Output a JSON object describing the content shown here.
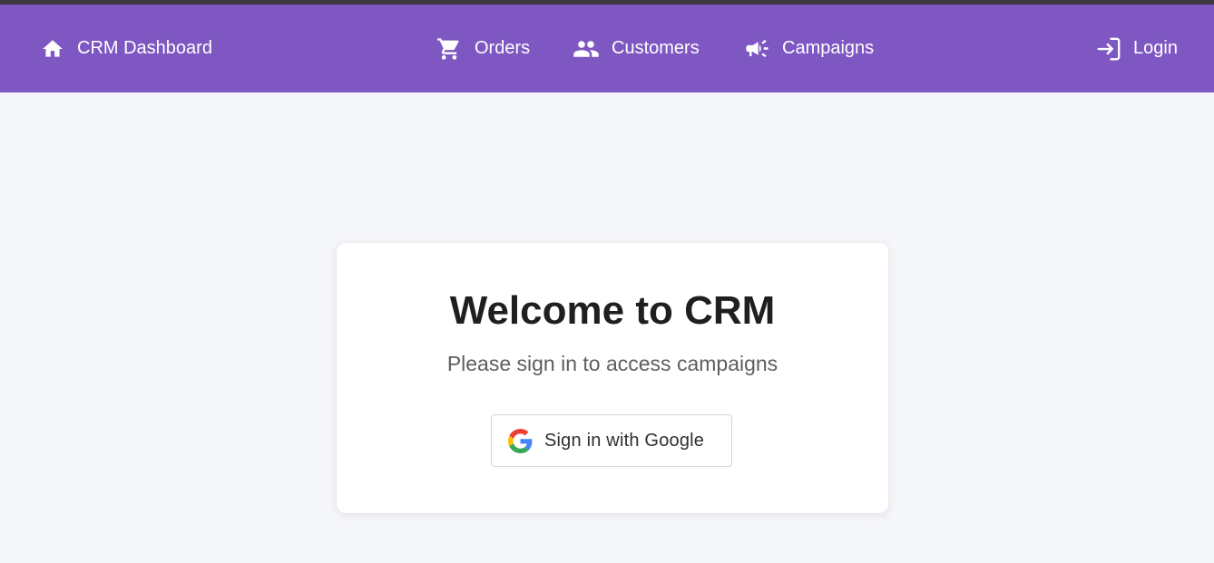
{
  "navbar": {
    "background": "#7e57c2",
    "brand": {
      "label": "CRM Dashboard",
      "icon": "home-icon"
    },
    "items": [
      {
        "label": "Orders",
        "icon": "cart-icon"
      },
      {
        "label": "Customers",
        "icon": "people-icon"
      },
      {
        "label": "Campaigns",
        "icon": "megaphone-icon"
      }
    ],
    "login": {
      "label": "Login",
      "icon": "login-icon"
    }
  },
  "card": {
    "title": "Welcome to CRM",
    "subtitle": "Please sign in to access campaigns",
    "google_button": {
      "label": "Sign in with Google",
      "icon": "google-icon"
    }
  }
}
